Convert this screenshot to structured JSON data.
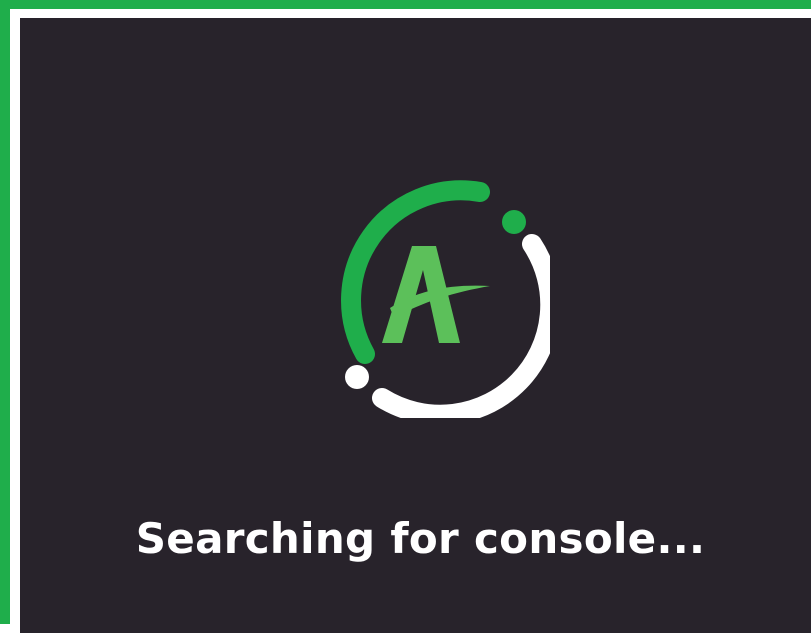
{
  "loading_screen": {
    "status_text": "Searching for console...",
    "logo_letter": "A",
    "icons": {
      "spinner": "loading-spinner-icon",
      "logo": "app-logo-icon"
    },
    "colors": {
      "background": "#28232b",
      "accent": "#1fae4b",
      "logo_green": "#5cc05a",
      "text": "#ffffff"
    }
  }
}
